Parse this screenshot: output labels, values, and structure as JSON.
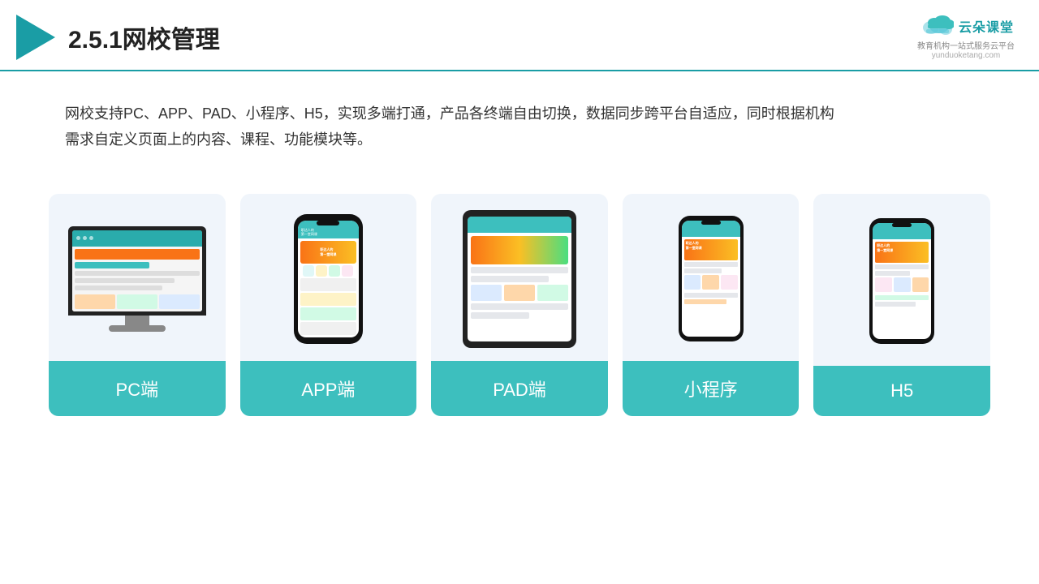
{
  "header": {
    "title": "2.5.1网校管理",
    "logo_cn": "云朵课堂",
    "logo_sub1": "教育机构一站",
    "logo_sub2": "式服务云平台",
    "logo_url": "yunduoketang.com"
  },
  "description": {
    "text1": "网校支持PC、APP、PAD、小程序、H5，实现多端打通，产品各终端自由切换，数据同步跨平台自适应，同时根据机构",
    "text2": "需求自定义页面上的内容、课程、功能模块等。"
  },
  "cards": [
    {
      "id": "pc",
      "label": "PC端"
    },
    {
      "id": "app",
      "label": "APP端"
    },
    {
      "id": "pad",
      "label": "PAD端"
    },
    {
      "id": "miniprogram",
      "label": "小程序"
    },
    {
      "id": "h5",
      "label": "H5"
    }
  ],
  "colors": {
    "teal": "#3dbfbe",
    "accent": "#1a9da5"
  }
}
